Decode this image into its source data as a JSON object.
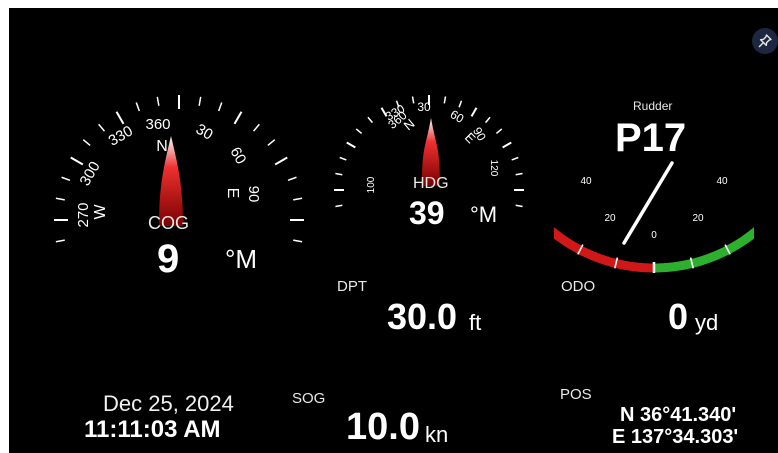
{
  "controls": {
    "pin_icon": "pin-icon"
  },
  "cog": {
    "label": "COG",
    "value": "9",
    "unit": "°M",
    "heading_deg": 9,
    "ticks": {
      "n330": "330",
      "n360": "360",
      "n30": "30",
      "n60": "60",
      "n90": "90",
      "n300": "300",
      "n270": "270",
      "N": "N",
      "E": "E",
      "W": "W"
    }
  },
  "hdg": {
    "label": "HDG",
    "value": "39",
    "unit": "°M",
    "heading_deg": 39,
    "ticks": {
      "n330": "330",
      "n360": "360",
      "n30": "30",
      "n60": "60",
      "n90": "90",
      "n120": "120",
      "n100": "100",
      "N": "N",
      "E": "E"
    }
  },
  "rudder": {
    "label": "Rudder",
    "value": "P17",
    "angle_deg": -17,
    "scale_max_deg": 40,
    "port_color": "#d01818",
    "starboard_color": "#2db02d",
    "ticks": {
      "p40": "40",
      "p20": "20",
      "zero": "0",
      "s20": "20",
      "s40": "40"
    }
  },
  "dpt": {
    "label": "DPT",
    "value": "30.0",
    "unit": "ft"
  },
  "odo": {
    "label": "ODO",
    "value": "0",
    "unit": "yd"
  },
  "datetime": {
    "date": "Dec 25, 2024",
    "time": "11:11:03 AM"
  },
  "sog": {
    "label": "SOG",
    "value": "10.0",
    "unit": "kn"
  },
  "pos": {
    "label": "POS",
    "lat": "N 36°41.340'",
    "lon": "E 137°34.303'"
  }
}
